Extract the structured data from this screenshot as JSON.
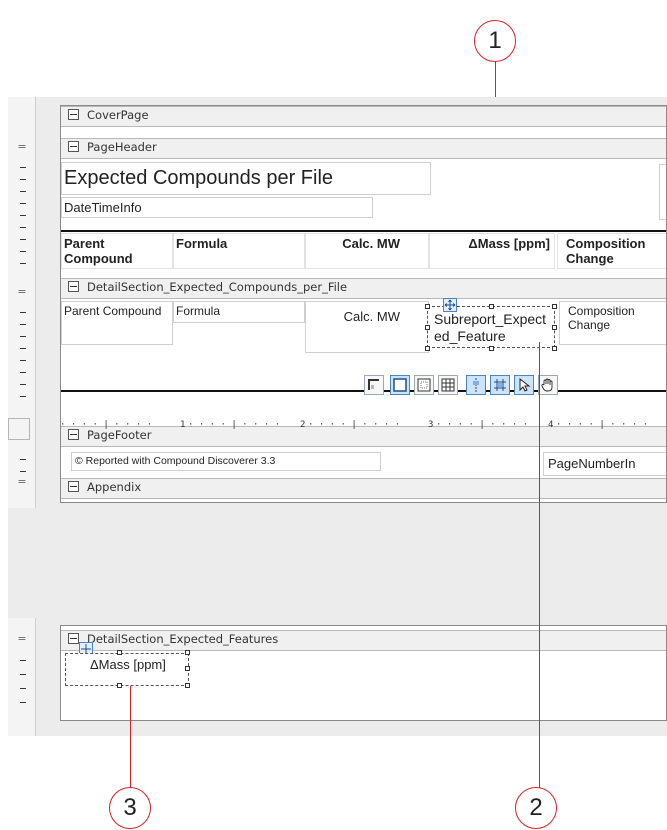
{
  "callouts": [
    {
      "number": "1"
    },
    {
      "number": "2"
    },
    {
      "number": "3"
    }
  ],
  "bands": {
    "cover": "CoverPage",
    "page_header": "PageHeader",
    "detail_compounds": "DetailSection_Expected_Compounds_per_File",
    "page_footer": "PageFooter",
    "appendix": "Appendix",
    "detail_features": "DetailSection_Expected_Features"
  },
  "header": {
    "title": "Expected Compounds per File",
    "datetime": "DateTimeInfo"
  },
  "columns_header": [
    {
      "label": "Parent Compound"
    },
    {
      "label": "Formula"
    },
    {
      "label": "Calc. MW"
    },
    {
      "label": "ΔMass [ppm]"
    },
    {
      "label": "Composition Change"
    }
  ],
  "detail_fields": {
    "parent": "Parent Compound",
    "formula": "Formula",
    "calc_mw": "Calc. MW",
    "subreport": "Subreport_Expected_Feature",
    "composition": "Composition Change"
  },
  "footer": {
    "copyright": "© Reported with Compound Discoverer 3.3",
    "page_number": "PageNumberIn"
  },
  "features_field": "ΔMass [ppm]",
  "ruler_labels": [
    "1",
    "2",
    "3",
    "4"
  ],
  "toolbar": [
    {
      "icon": "corner-icon"
    },
    {
      "icon": "box-icon"
    },
    {
      "icon": "small-grid-icon"
    },
    {
      "icon": "grid-icon"
    },
    {
      "icon": "snap-lines-icon"
    },
    {
      "icon": "snap-grid-icon"
    },
    {
      "icon": "pointer-icon"
    },
    {
      "icon": "hand-icon"
    }
  ],
  "colors": {
    "callout": "#d2232a",
    "accent": "#4b83c4"
  }
}
